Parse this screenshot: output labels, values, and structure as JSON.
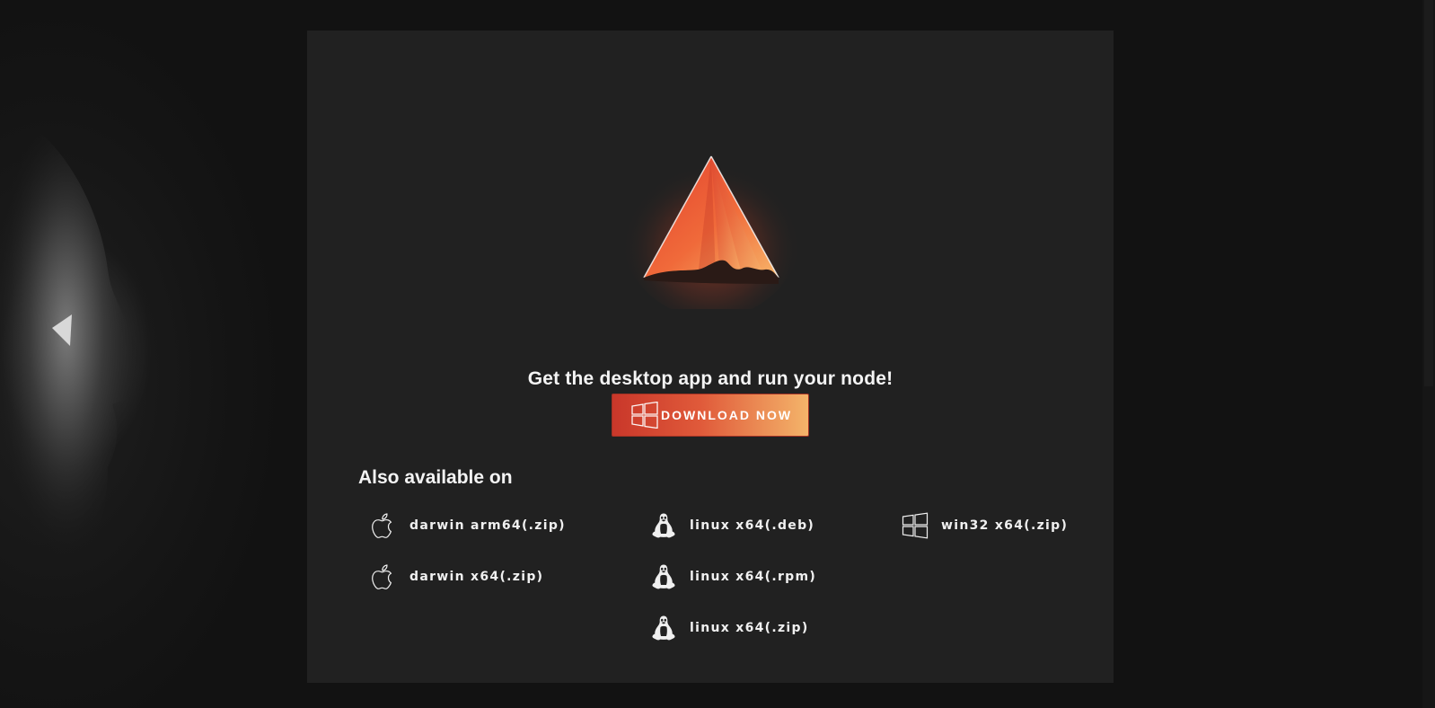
{
  "headline": "Get the desktop app and run your node!",
  "download_button": {
    "label": "DOWNLOAD NOW",
    "icon": "windows-icon"
  },
  "also_available": {
    "title": "Also available on",
    "platforms": [
      {
        "label": "darwin arm64(.zip)",
        "icon": "apple-icon"
      },
      {
        "label": "darwin x64(.zip)",
        "icon": "apple-icon"
      },
      {
        "label": "linux x64(.deb)",
        "icon": "linux-tux-icon"
      },
      {
        "label": "linux x64(.rpm)",
        "icon": "linux-tux-icon"
      },
      {
        "label": "linux x64(.zip)",
        "icon": "linux-tux-icon"
      },
      {
        "label": "win32 x64(.zip)",
        "icon": "windows-icon"
      }
    ]
  },
  "colors": {
    "page_bg": "#141414",
    "panel_bg": "#212121",
    "button_gradient_start": "#c9372a",
    "button_gradient_end": "#f4b46a",
    "text": "#f4f4f4"
  }
}
